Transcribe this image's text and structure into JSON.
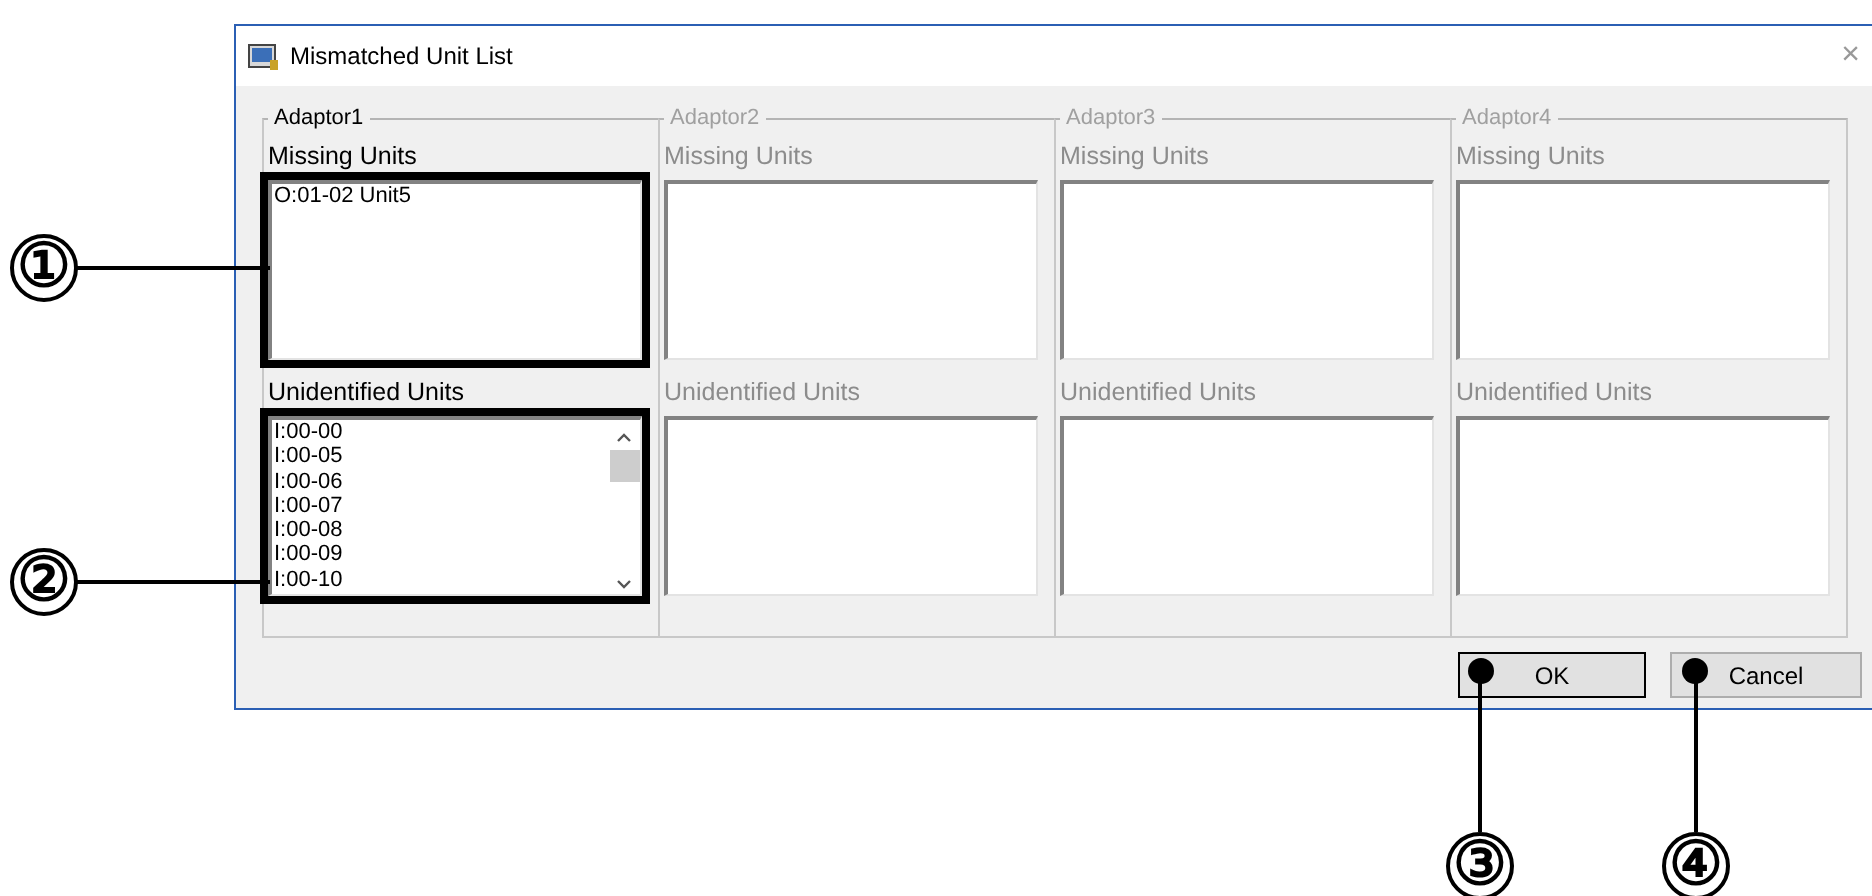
{
  "window": {
    "title": "Mismatched Unit List",
    "close": "×"
  },
  "adaptors": [
    {
      "name": "Adaptor1",
      "disabled": false,
      "missing": {
        "label": "Missing Units",
        "items": [
          "O:01-02 Unit5"
        ],
        "highlighted": true
      },
      "unidentified": {
        "label": "Unidentified Units",
        "items": [
          "I:00-00",
          "I:00-05",
          "I:00-06",
          "I:00-07",
          "I:00-08",
          "I:00-09",
          "I:00-10"
        ],
        "highlighted": true,
        "scrollbar": true
      }
    },
    {
      "name": "Adaptor2",
      "disabled": true,
      "missing": {
        "label": "Missing Units",
        "highlighted": false
      },
      "unidentified": {
        "label": "Unidentified Units",
        "highlighted": false
      }
    },
    {
      "name": "Adaptor3",
      "disabled": true,
      "missing": {
        "label": "Missing Units",
        "highlighted": false
      },
      "unidentified": {
        "label": "Unidentified Units",
        "highlighted": false
      }
    },
    {
      "name": "Adaptor4",
      "disabled": true,
      "missing": {
        "label": "Missing Units",
        "highlighted": false
      },
      "unidentified": {
        "label": "Unidentified Units",
        "highlighted": false
      }
    }
  ],
  "buttons": [
    {
      "label": "OK",
      "default": true
    },
    {
      "label": "Cancel",
      "default": false
    }
  ],
  "callouts": [
    {
      "number": "①"
    },
    {
      "number": "②"
    },
    {
      "number": "③"
    },
    {
      "number": "④"
    }
  ]
}
